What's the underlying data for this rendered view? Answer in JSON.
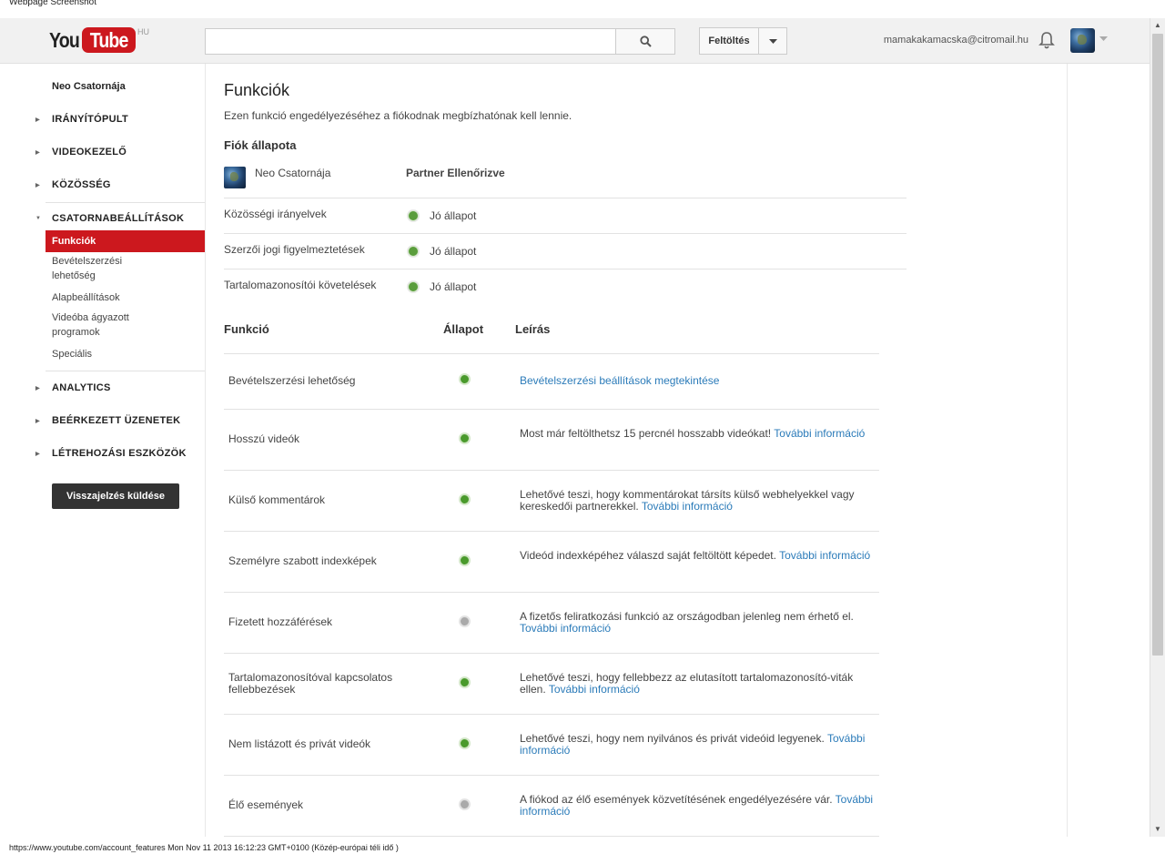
{
  "caption": "Webpage Screenshot",
  "header": {
    "logo_you": "You",
    "logo_tube": "Tube",
    "logo_region": "HU",
    "search_placeholder": "",
    "upload_label": "Feltöltés",
    "user_email": "mamakakamacska@citromail.hu"
  },
  "sidebar": {
    "channel_name": "Neo Csatornája",
    "sections": [
      {
        "label": "IRÁNYÍTÓPULT"
      },
      {
        "label": "VIDEOKEZELŐ"
      },
      {
        "label": "KÖZÖSSÉG"
      },
      {
        "label": "CSATORNABEÁLLÍTÁSOK"
      },
      {
        "label": "ANALYTICS"
      },
      {
        "label": "BEÉRKEZETT ÜZENETEK"
      },
      {
        "label": "LÉTREHOZÁSI ESZKÖZÖK"
      }
    ],
    "sub_items": [
      "Funkciók",
      "Bevételszerzési lehetőség",
      "Alapbeállítások",
      "Videóba ágyazott programok",
      "Speciális"
    ],
    "feedback_label": "Visszajelzés küldése"
  },
  "main": {
    "title": "Funkciók",
    "description": "Ezen funkció engedélyezéséhez a fiókodnak megbízhatónak kell lennie.",
    "status_heading": "Fiók állapota",
    "status_channel": "Neo Csatornája",
    "status_partner": "Partner Ellenőrizve",
    "status_rows": [
      {
        "label": "Közösségi irányelvek",
        "value": "Jó állapot"
      },
      {
        "label": "Szerzői jogi figyelmeztetések",
        "value": "Jó állapot"
      },
      {
        "label": "Tartalomazonosítói követelések",
        "value": "Jó állapot"
      }
    ],
    "table_headers": {
      "feature": "Funkció",
      "state": "Állapot",
      "desc": "Leírás"
    },
    "features": [
      {
        "name": "Bevételszerzési lehetőség",
        "enabled": true,
        "desc": "",
        "link": "Bevételszerzési beállítások megtekintése"
      },
      {
        "name": "Hosszú videók",
        "enabled": true,
        "desc": "Most már feltölthetsz 15 percnél hosszabb videókat!",
        "link": "További információ"
      },
      {
        "name": "Külső kommentárok",
        "enabled": true,
        "desc": "Lehetővé teszi, hogy kommentárokat társíts külső webhelyekkel vagy kereskedői partnerekkel.",
        "link": "További információ"
      },
      {
        "name": "Személyre szabott indexképek",
        "enabled": true,
        "desc": "Videód indexképéhez válaszd saját feltöltött képedet.",
        "link": "További információ"
      },
      {
        "name": "Fizetett hozzáférések",
        "enabled": false,
        "desc": "A fizetős feliratkozási funkció az országodban jelenleg nem érhető el.",
        "link": "További információ"
      },
      {
        "name": "Tartalomazonosítóval kapcsolatos fellebbezések",
        "enabled": true,
        "desc": "Lehetővé teszi, hogy fellebbezz az elutasított tartalomazonosító-viták ellen.",
        "link": "További információ"
      },
      {
        "name": "Nem listázott és privát videók",
        "enabled": true,
        "desc": "Lehetővé teszi, hogy nem nyilvános és privát videóid legyenek.",
        "link": "További információ"
      },
      {
        "name": "Élő események",
        "enabled": false,
        "desc": "A fiókod az élő események közvetítésének engedélyezésére vár.",
        "link": "További információ"
      }
    ]
  },
  "status_bar": "https://www.youtube.com/account_features Mon Nov 11 2013 16:12:23 GMT+0100 (Közép-európai téli idő )",
  "colors": {
    "brand": "#cc181e",
    "link": "#2b7bb9",
    "enabled": "#4a9a2c",
    "disabled": "#aaaaaa"
  }
}
